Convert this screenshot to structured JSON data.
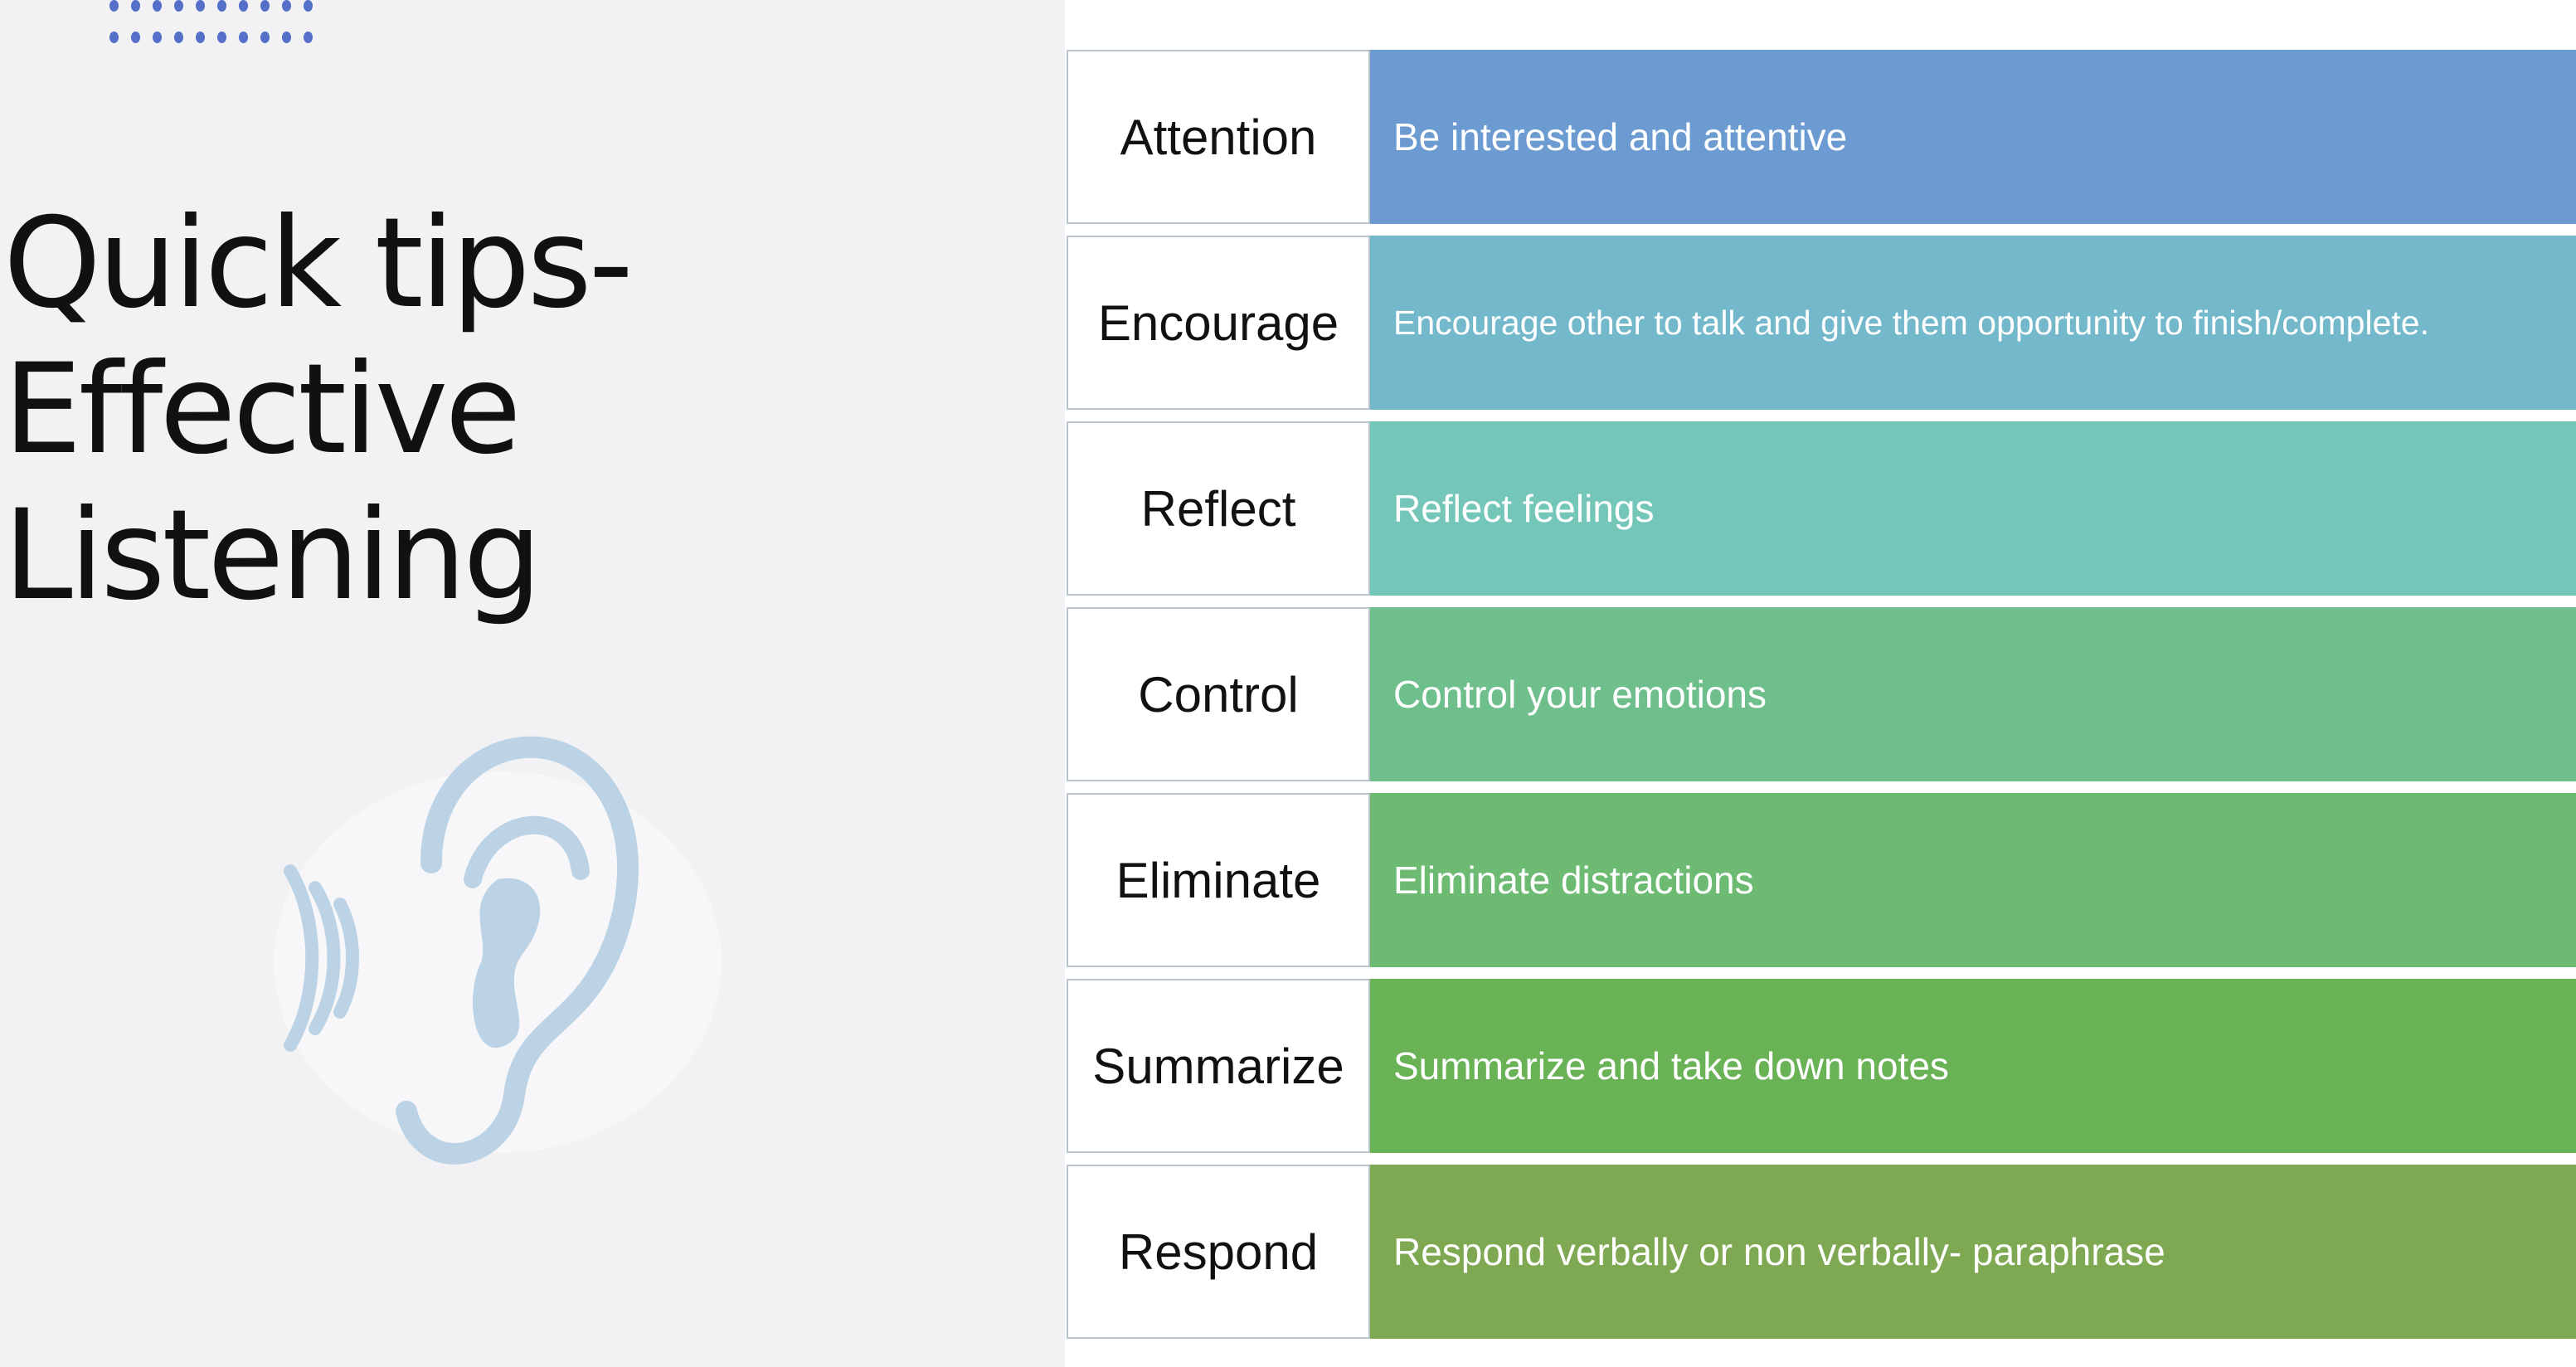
{
  "title": {
    "line1": "Quick tips-",
    "line2": "Effective Listening"
  },
  "icons": {
    "decoration": "dot-grid",
    "illustration": "ear-with-sound-waves-icon"
  },
  "tips": [
    {
      "label": "Attention",
      "description": "Be interested and attentive",
      "color": "#6b9bd1"
    },
    {
      "label": "Encourage",
      "description": "Encourage other to talk and give them opportunity to finish/complete.",
      "color": "#73b8cb"
    },
    {
      "label": "Reflect",
      "description": "Reflect feelings",
      "color": "#74c6b8"
    },
    {
      "label": "Control",
      "description": "Control your emotions",
      "color": "#6fbf8c"
    },
    {
      "label": "Eliminate",
      "description": "Eliminate distractions",
      "color": "#6dbb72"
    },
    {
      "label": "Summarize",
      "description": "Summarize and take down notes",
      "color": "#69b356"
    },
    {
      "label": "Respond",
      "description": "Respond verbally or non verbally- paraphrase",
      "color": "#7fa853"
    }
  ]
}
